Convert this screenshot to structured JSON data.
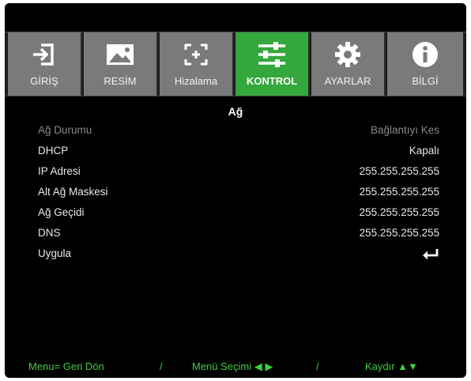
{
  "tabs": [
    {
      "label": "GİRİŞ",
      "icon": "input-icon",
      "active": false
    },
    {
      "label": "RESİM",
      "icon": "image-icon",
      "active": false
    },
    {
      "label": "Hizalama",
      "icon": "alignment-icon",
      "active": false
    },
    {
      "label": "KONTROL",
      "icon": "sliders-icon",
      "active": true
    },
    {
      "label": "AYARLAR",
      "icon": "gear-icon",
      "active": false
    },
    {
      "label": "BİLGİ",
      "icon": "info-icon",
      "active": false
    }
  ],
  "section": {
    "title": "Ağ"
  },
  "rows": [
    {
      "label": "Ağ Durumu",
      "value": "Bağlantıyı Kes",
      "disabled": true
    },
    {
      "label": "DHCP",
      "value": "Kapalı",
      "disabled": false
    },
    {
      "label": "IP Adresi",
      "value": "255.255.255.255",
      "disabled": false
    },
    {
      "label": "Alt Ağ Maskesi",
      "value": "255.255.255.255",
      "disabled": false
    },
    {
      "label": "Ağ Geçidi",
      "value": "255.255.255.255",
      "disabled": false
    },
    {
      "label": "DNS",
      "value": "255.255.255.255",
      "disabled": false
    },
    {
      "label": "Uygula",
      "value": "",
      "icon": "enter-icon",
      "disabled": false
    }
  ],
  "footer": {
    "back": "Menu= Geri Dön",
    "sep1": "/",
    "menu_select": "Menü Seçimi ◀ ▶",
    "sep2": "/",
    "scroll": "Kaydır ▲▼"
  },
  "colors": {
    "active_tab": "#34a83c",
    "tab": "#7a7a7a",
    "footer_text": "#3ecf3e"
  }
}
